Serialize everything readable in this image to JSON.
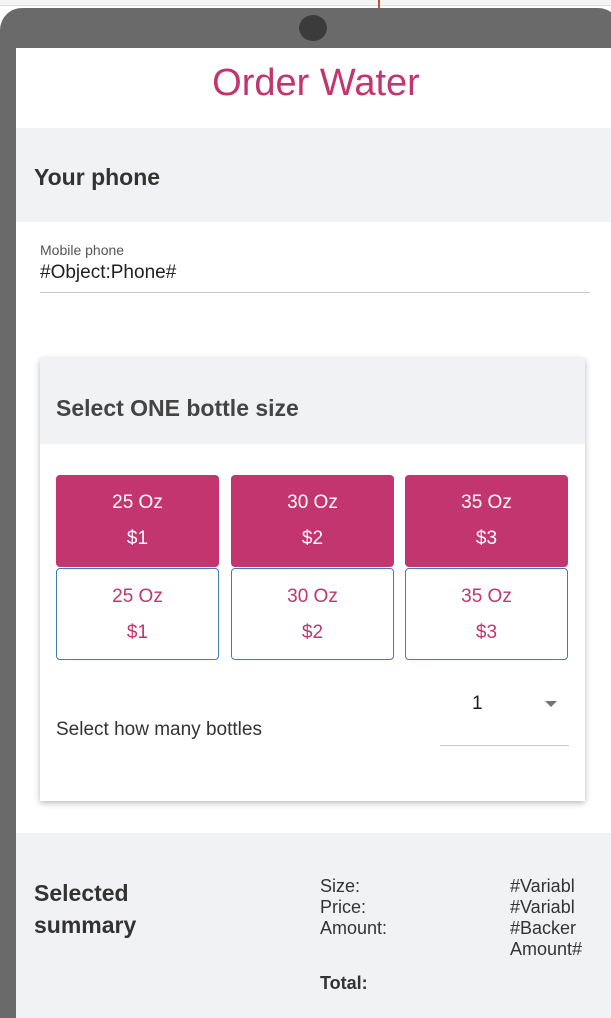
{
  "app": {
    "title": "Order Water"
  },
  "phone_section": {
    "heading": "Your phone",
    "field_label": "Mobile phone",
    "field_value": "#Object:Phone#"
  },
  "bottle_card": {
    "heading": "Select ONE bottle size",
    "filled_options": [
      {
        "size": "25 Oz",
        "price": "$1"
      },
      {
        "size": "30 Oz",
        "price": "$2"
      },
      {
        "size": "35 Oz",
        "price": "$3"
      }
    ],
    "outlined_options": [
      {
        "size": "25 Oz",
        "price": "$1"
      },
      {
        "size": "30 Oz",
        "price": "$2"
      },
      {
        "size": "35 Oz",
        "price": "$3"
      }
    ],
    "quantity_label": "Select how many bottles",
    "quantity_value": "1"
  },
  "summary": {
    "heading_line1": "Selected",
    "heading_line2": "summary",
    "labels": [
      "Size:",
      "Price:",
      "Amount:"
    ],
    "values": [
      "#Variabl",
      "#Variabl",
      "#Backer",
      "Amount#"
    ],
    "total_label": "Total:"
  },
  "colors": {
    "accent": "#c2356e",
    "outline_border": "#3b7bbf",
    "section_bg": "#f1f2f4",
    "device_frame": "#6a6a6a"
  }
}
